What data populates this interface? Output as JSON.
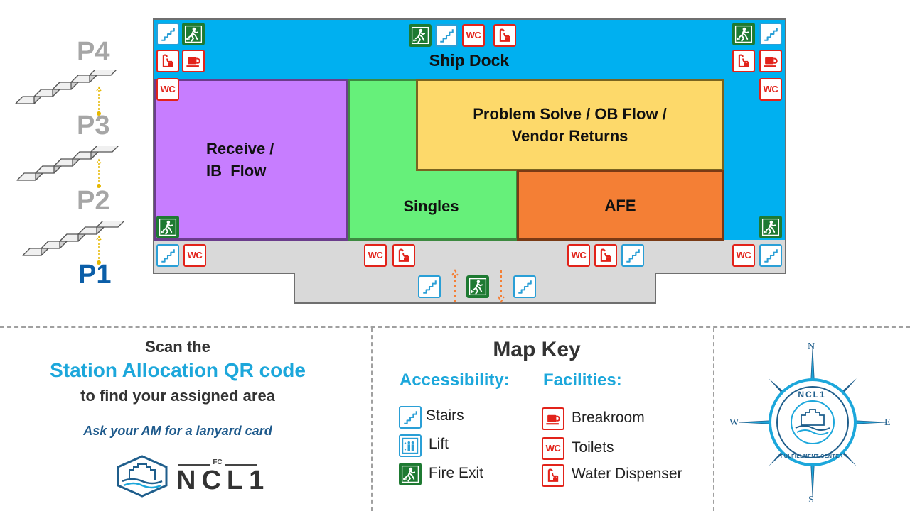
{
  "floors": {
    "p4": "P4",
    "p3": "P3",
    "p2": "P2",
    "p1": "P1",
    "current": "P1",
    "current_color": "#0b5ea8",
    "inactive_color": "#a6a6a6"
  },
  "zones": {
    "ship_dock": "Ship Dock",
    "receive": "Receive /\nIB  Flow",
    "singles": "Singles",
    "problem_solve": "Problem Solve / OB Flow /\nVendor Returns",
    "afe": "AFE"
  },
  "zone_colors": {
    "ship_dock": "#00b0f0",
    "receive": "#c77dff",
    "singles": "#66f07a",
    "problem_solve": "#fdd96a",
    "afe": "#f47f35",
    "corridor": "#d9d9d9"
  },
  "wc_label": "WC",
  "scan": {
    "line1": "Scan the",
    "line2": "Station Allocation QR code",
    "line3": "to find your assigned area",
    "note": "Ask your AM for a lanyard card",
    "logo_small": "FC",
    "logo_text": "NCL1"
  },
  "map_key": {
    "title": "Map Key",
    "accessibility_header": "Accessibility:",
    "facilities_header": "Facilities:",
    "accessibility": [
      {
        "icon": "stairs-icon",
        "label": "Stairs"
      },
      {
        "icon": "lift-icon",
        "label": "Lift"
      },
      {
        "icon": "fire-exit-icon",
        "label": "Fire Exit"
      }
    ],
    "facilities": [
      {
        "icon": "breakroom-icon",
        "label": "Breakroom"
      },
      {
        "icon": "toilets-icon",
        "label": "Toilets"
      },
      {
        "icon": "water-dispenser-icon",
        "label": "Water Dispenser"
      }
    ]
  },
  "compass": {
    "n": "N",
    "s": "S",
    "e": "E",
    "w": "W",
    "badge_top": "NCL1",
    "badge_bottom": "FULFILLMENT CENTER"
  },
  "colors": {
    "accent_blue": "#1ca7db",
    "icon_red": "#e2231a",
    "icon_green": "#1e7a32",
    "text_dark": "#333333"
  }
}
